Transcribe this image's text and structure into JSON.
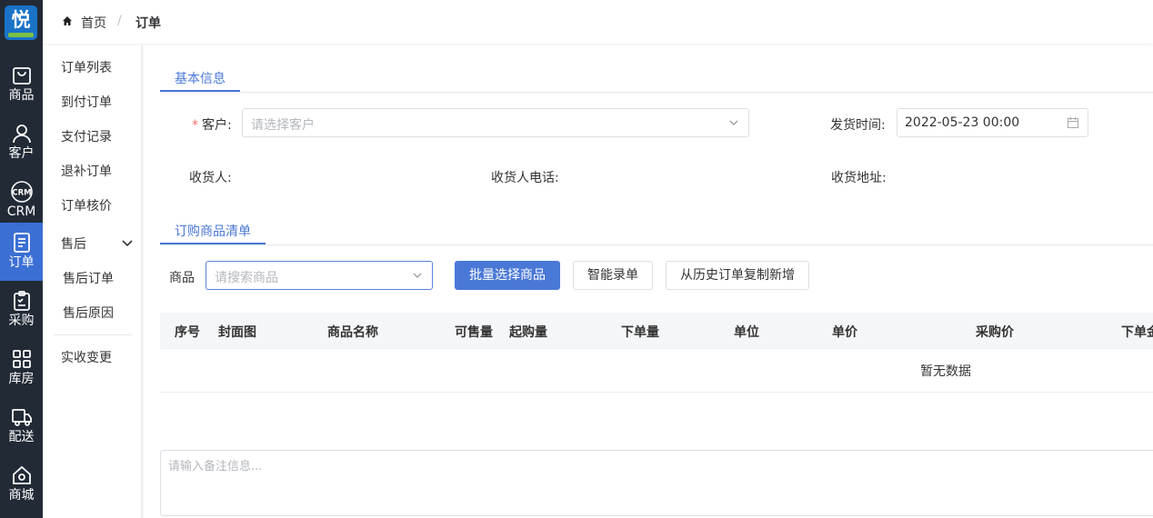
{
  "logo": {
    "text": "悦"
  },
  "rail": {
    "items": [
      {
        "label": "商品",
        "icon": "shopping-bag-icon"
      },
      {
        "label": "客户",
        "icon": "user-icon"
      },
      {
        "label": "CRM",
        "icon": "crm-icon",
        "badge": "CRM"
      },
      {
        "label": "订单",
        "icon": "document-icon",
        "active": true
      },
      {
        "label": "采购",
        "icon": "clipboard-icon"
      },
      {
        "label": "库房",
        "icon": "grid-icon"
      },
      {
        "label": "配送",
        "icon": "truck-icon"
      },
      {
        "label": "商城",
        "icon": "store-icon"
      }
    ],
    "colors": {
      "background": "#222a36",
      "active": "#3b6fd4"
    }
  },
  "subnav": {
    "items": [
      {
        "label": "订单列表"
      },
      {
        "label": "到付订单"
      },
      {
        "label": "支付记录"
      },
      {
        "label": "退补订单"
      },
      {
        "label": "订单核价"
      }
    ],
    "group": {
      "label": "售后",
      "children": [
        "售后订单",
        "售后原因"
      ]
    },
    "extra": "实收变更"
  },
  "breadcrumb": {
    "home": "首页",
    "separator": "/",
    "current": "订单"
  },
  "tabs": {
    "basic": "基本信息",
    "goods": "订购商品清单"
  },
  "form": {
    "customer_label": "客户:",
    "customer_required": "*",
    "customer_placeholder": "请选择客户",
    "ship_time_label": "发货时间:",
    "ship_time_value": "2022-05-23 00:00",
    "receiver_label": "收货人:",
    "receiver_phone_label": "收货人电话:",
    "receiver_address_label": "收货地址:"
  },
  "goods": {
    "search_label": "商品",
    "search_placeholder": "请搜索商品",
    "batch_select": "批量选择商品",
    "smart_entry": "智能录单",
    "copy_history": "从历史订单复制新增"
  },
  "table": {
    "columns": [
      "序号",
      "封面图",
      "商品名称",
      "可售量",
      "起购量",
      "下单量",
      "单位",
      "单价",
      "采购价",
      "下单金"
    ],
    "empty": "暂无数据"
  },
  "remark": {
    "placeholder": "请输入备注信息..."
  },
  "accent": "#4a78d6"
}
